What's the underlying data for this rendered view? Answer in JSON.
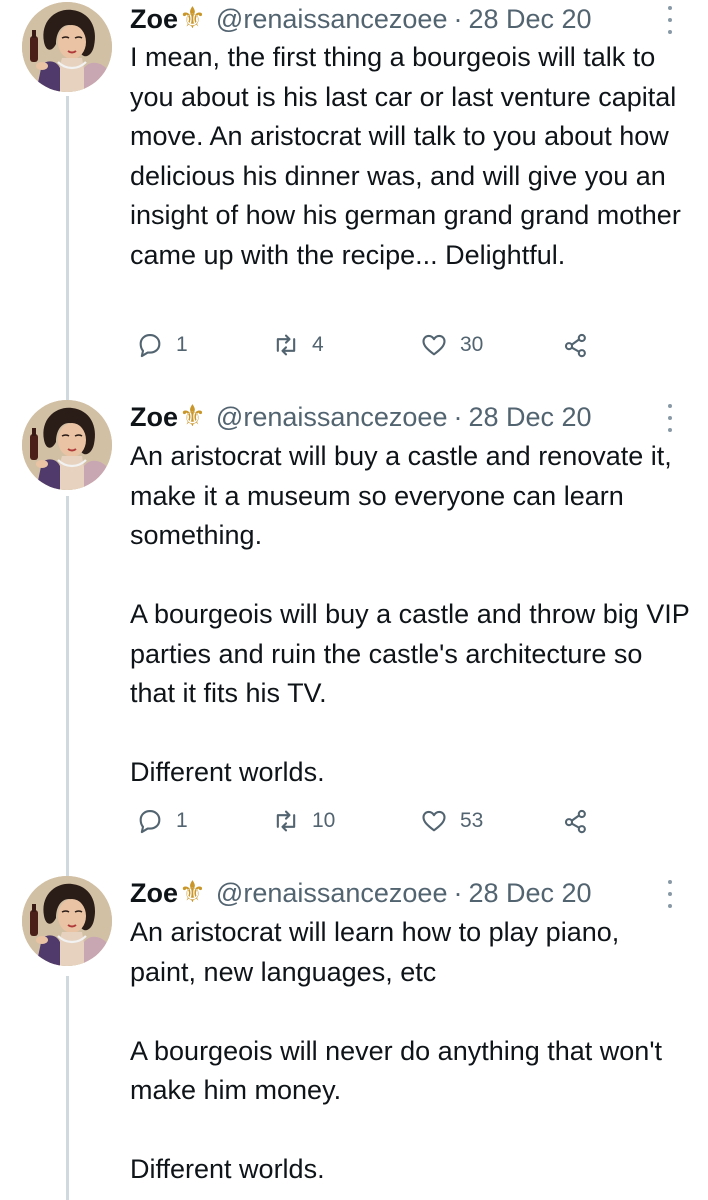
{
  "colors": {
    "text": "#0f1419",
    "secondary": "#536471",
    "thread_line": "#cfd9de",
    "fleur_de_lis": "#c9962a"
  },
  "tweets": [
    {
      "author": {
        "name": "Zoe",
        "emoji": "⚜",
        "handle": "@renaissancezoee",
        "separator": "·",
        "date": "28 Dec 20",
        "avatar_icon": "vintage-woman-portrait-avatar"
      },
      "paragraphs": [
        "I mean, the first thing a bourgeois will talk to you about is his last car or last venture capital move. An aristocrat will talk to you about how delicious his dinner was, and will give you an insight of how his german grand grand mother came up with the recipe... Delightful."
      ],
      "stats": {
        "replies": "1",
        "retweets": "4",
        "likes": "30"
      }
    },
    {
      "author": {
        "name": "Zoe",
        "emoji": "⚜",
        "handle": "@renaissancezoee",
        "separator": "·",
        "date": "28 Dec 20",
        "avatar_icon": "vintage-woman-portrait-avatar"
      },
      "paragraphs": [
        "An aristocrat will buy a castle and renovate it, make it a museum so everyone can learn something.",
        "A bourgeois will buy a castle and throw big VIP parties and ruin the castle's architecture so that it fits his TV.",
        "Different worlds."
      ],
      "stats": {
        "replies": "1",
        "retweets": "10",
        "likes": "53"
      }
    },
    {
      "author": {
        "name": "Zoe",
        "emoji": "⚜",
        "handle": "@renaissancezoee",
        "separator": "·",
        "date": "28 Dec 20",
        "avatar_icon": "vintage-woman-portrait-avatar"
      },
      "paragraphs": [
        "An aristocrat will learn how to play piano, paint, new languages, etc",
        "A bourgeois will never do anything that won't make him money.",
        "Different worlds."
      ]
    }
  ]
}
